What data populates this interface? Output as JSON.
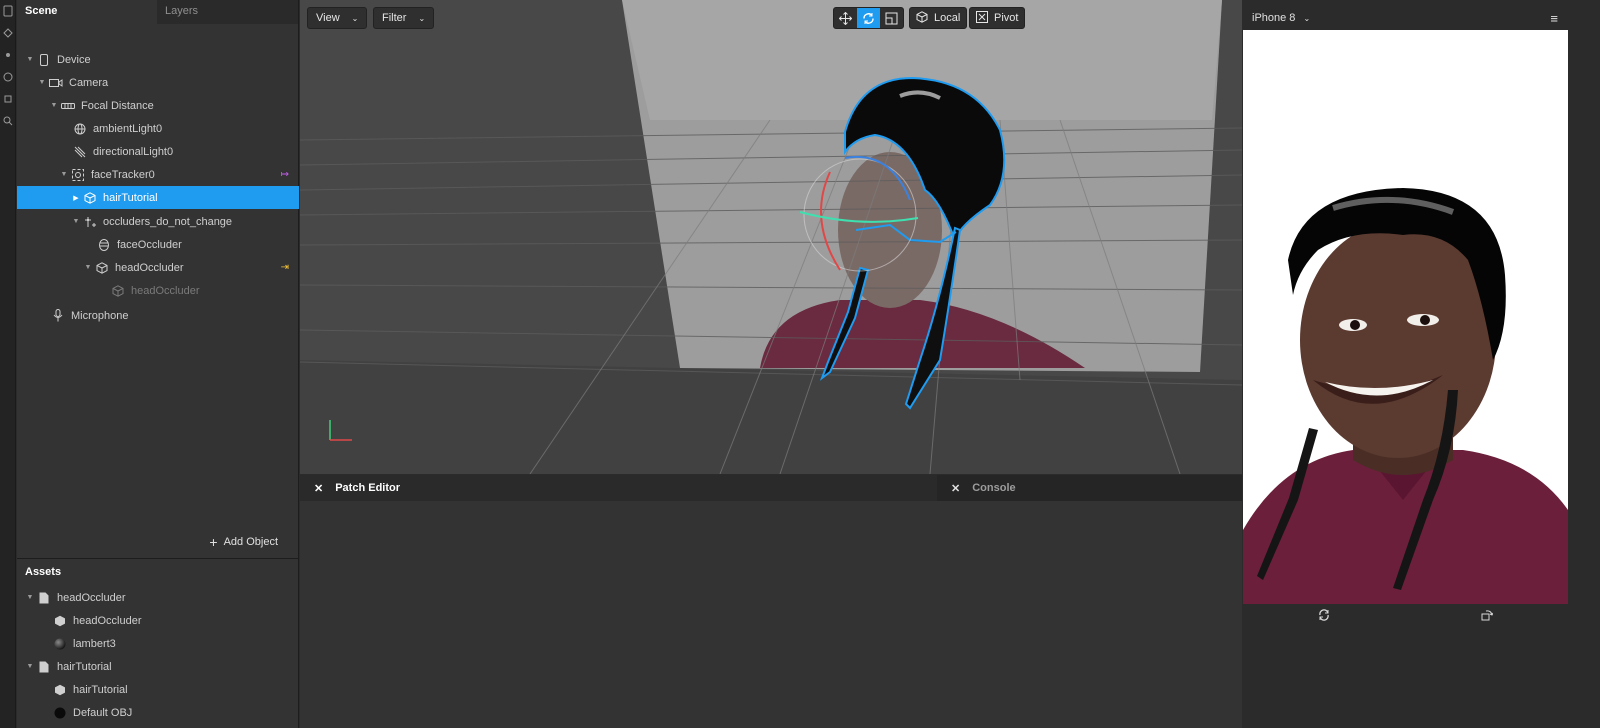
{
  "scene_panel": {
    "tabs": [
      "Scene",
      "Layers"
    ],
    "tree": [
      {
        "label": "Device",
        "icon": "phone-icon"
      },
      {
        "label": "Camera",
        "icon": "camera-icon"
      },
      {
        "label": "Focal Distance",
        "icon": "focal-distance-icon"
      },
      {
        "label": "ambientLight0",
        "icon": "globe-light-icon"
      },
      {
        "label": "directionalLight0",
        "icon": "directional-light-icon"
      },
      {
        "label": "faceTracker0",
        "icon": "face-tracker-icon"
      },
      {
        "label": "hairTutorial",
        "icon": "cube-icon"
      },
      {
        "label": "occluders_do_not_change",
        "icon": "null-object-icon"
      },
      {
        "label": "faceOccluder",
        "icon": "face-mesh-icon"
      },
      {
        "label": "headOccluder",
        "icon": "cube-icon"
      },
      {
        "label": "headOccluder",
        "icon": "cube-icon"
      },
      {
        "label": "Microphone",
        "icon": "microphone-icon"
      }
    ],
    "add_object": "Add Object"
  },
  "assets_panel": {
    "title": "Assets",
    "items": [
      {
        "label": "headOccluder",
        "icon": "file-icon"
      },
      {
        "label": "headOccluder",
        "icon": "cube-icon"
      },
      {
        "label": "lambert3",
        "icon": "material-sphere-icon"
      },
      {
        "label": "hairTutorial",
        "icon": "file-icon"
      },
      {
        "label": "hairTutorial",
        "icon": "cube-icon"
      },
      {
        "label": "Default OBJ",
        "icon": "material-sphere-icon"
      }
    ]
  },
  "viewport": {
    "view_menu": "View",
    "filter_menu": "Filter",
    "local_button": "Local",
    "pivot_button": "Pivot",
    "tools": [
      "move-tool-icon",
      "rotate-tool-icon",
      "scale-tool-icon"
    ],
    "active_tool": "rotate-tool-icon",
    "selection_color": "#1f9bf0"
  },
  "bottom_panels": {
    "patch_editor": "Patch Editor",
    "console": "Console"
  },
  "simulator": {
    "device": "iPhone 8"
  },
  "colors": {
    "accent": "#1f9bf0",
    "panel": "#333333",
    "viewport": "#474747",
    "badge_purple": "#c65cf0",
    "badge_yellow": "#f0c23c"
  }
}
